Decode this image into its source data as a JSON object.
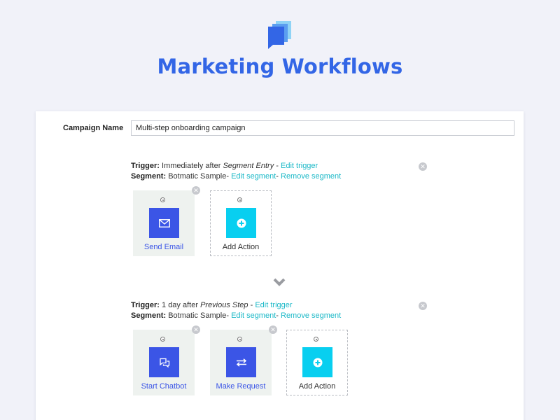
{
  "header": {
    "title": "Marketing Workflows",
    "logo_icon": "stacked-chat-bubbles-icon",
    "title_color": "#3366e6"
  },
  "campaign": {
    "label": "Campaign Name",
    "value": "Multi-step onboarding campaign"
  },
  "steps": [
    {
      "trigger_label": "Trigger:",
      "trigger_text": "Immediately after",
      "trigger_event": "Segment Entry",
      "sep": "-",
      "edit_trigger": "Edit trigger",
      "segment_label": "Segment:",
      "segment_name": "Botmatic Sample-",
      "edit_segment": "Edit segment",
      "sep2": "-",
      "remove_segment": "Remove segment",
      "actions": [
        {
          "label": "Send Email",
          "icon": "envelope-icon"
        },
        {
          "label": "Add Action",
          "icon": "plus-circle-icon",
          "type": "add"
        }
      ]
    },
    {
      "trigger_label": "Trigger:",
      "trigger_text": "1 day after",
      "trigger_event": "Previous Step",
      "sep": "-",
      "edit_trigger": "Edit trigger",
      "segment_label": "Segment:",
      "segment_name": "Botmatic Sample-",
      "edit_segment": "Edit segment",
      "sep2": "-",
      "remove_segment": "Remove segment",
      "actions": [
        {
          "label": "Start Chatbot",
          "icon": "chat-bubbles-icon"
        },
        {
          "label": "Make Request",
          "icon": "swap-arrows-icon"
        },
        {
          "label": "Add Action",
          "icon": "plus-circle-icon",
          "type": "add"
        }
      ]
    }
  ],
  "colors": {
    "action_tile": "#3b55e6",
    "add_tile": "#08cff0",
    "link": "#1ab8c7"
  }
}
